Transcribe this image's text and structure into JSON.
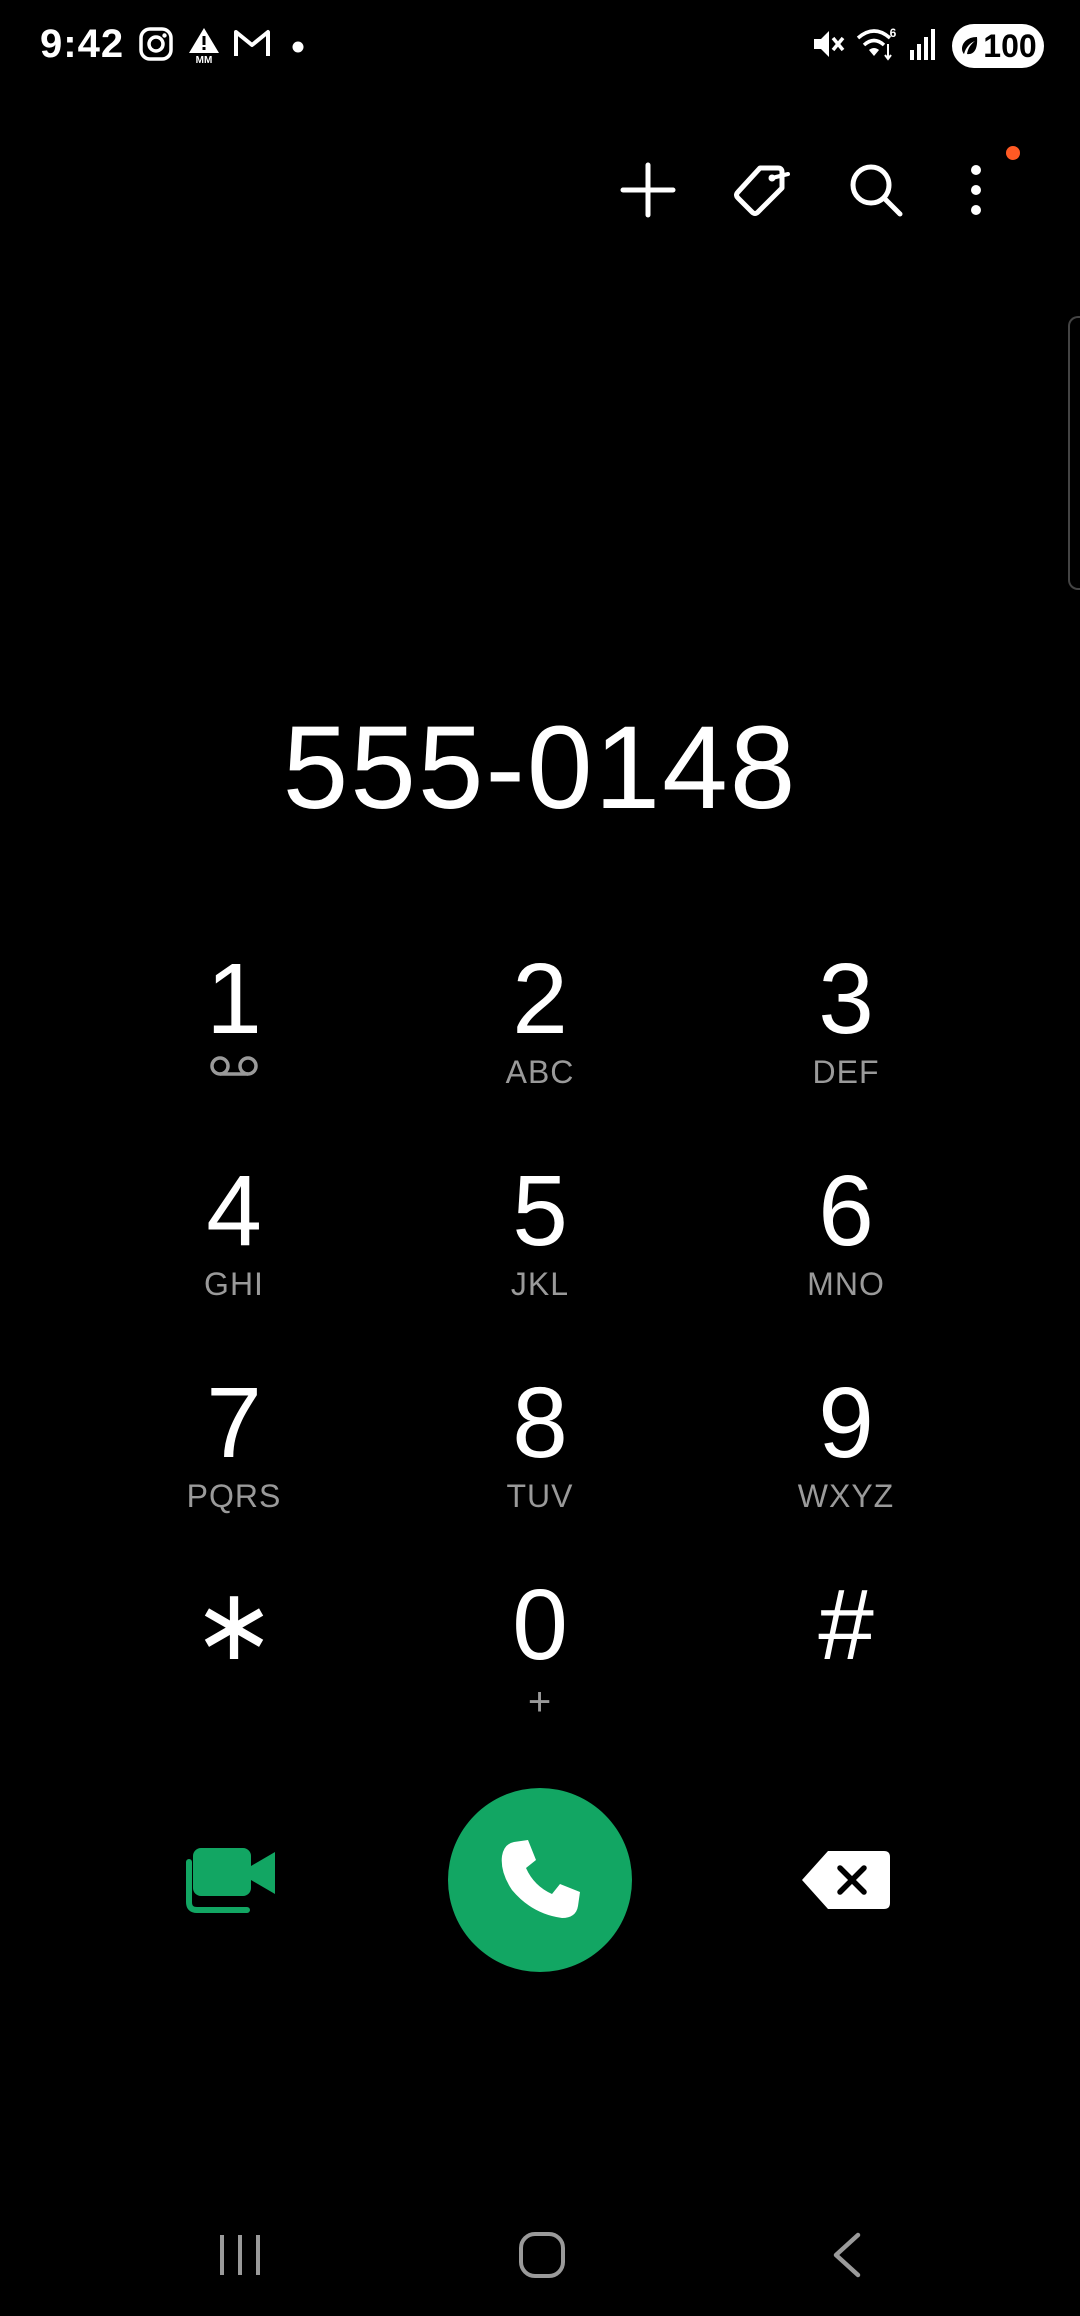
{
  "status_bar": {
    "time": "9:42",
    "battery": "100",
    "left_icons": [
      "instagram-icon",
      "alert-icon",
      "gmail-icon",
      "dot-icon"
    ],
    "right_icons": [
      "mute-icon",
      "wifi-icon",
      "signal-icon",
      "battery-icon"
    ],
    "wifi_label": "6"
  },
  "toolbar": {
    "icons": [
      "add-icon",
      "tag-icon",
      "search-icon",
      "more-icon"
    ],
    "accent": "#ff5a24"
  },
  "dialer": {
    "number": "555-0148",
    "keys": [
      {
        "digit": "1",
        "letters": ""
      },
      {
        "digit": "2",
        "letters": "ABC"
      },
      {
        "digit": "3",
        "letters": "DEF"
      },
      {
        "digit": "4",
        "letters": "GHI"
      },
      {
        "digit": "5",
        "letters": "JKL"
      },
      {
        "digit": "6",
        "letters": "MNO"
      },
      {
        "digit": "7",
        "letters": "PQRS"
      },
      {
        "digit": "8",
        "letters": "TUV"
      },
      {
        "digit": "9",
        "letters": "WXYZ"
      },
      {
        "digit": "∗",
        "letters": ""
      },
      {
        "digit": "0",
        "letters": "+"
      },
      {
        "digit": "#",
        "letters": ""
      }
    ]
  },
  "actions": {
    "call_color": "#12a663",
    "video_color": "#12a663",
    "icons": [
      "video-call-icon",
      "phone-icon",
      "backspace-icon"
    ]
  },
  "nav": {
    "icons": [
      "recents-icon",
      "home-icon",
      "back-icon"
    ]
  }
}
